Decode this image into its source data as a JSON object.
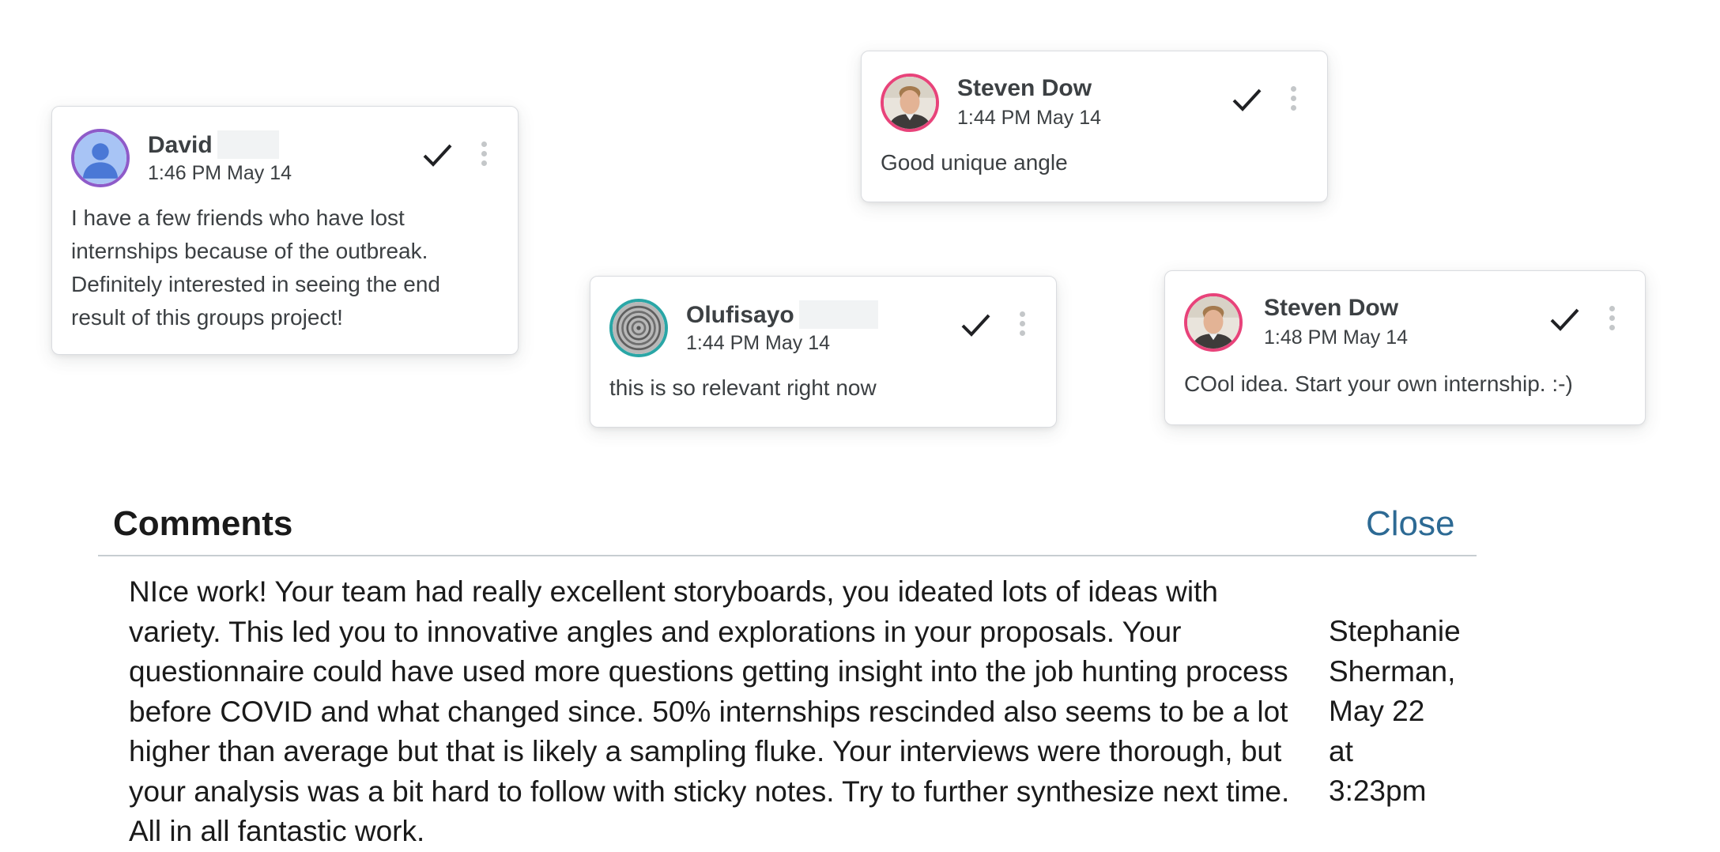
{
  "cards": [
    {
      "name": "David",
      "time": "1:46 PM May 14",
      "text": "I have a few friends who have lost internships because of the outbreak. Definitely interested in seeing the end result of this groups project!"
    },
    {
      "name": "Steven Dow",
      "time": "1:44 PM May 14",
      "text": "Good unique angle"
    },
    {
      "name": "Olufisayo",
      "time": "1:44 PM May 14",
      "text": "this is so relevant right now"
    },
    {
      "name": "Steven Dow",
      "time": "1:48 PM May 14",
      "text": "COol idea. Start your own internship. :-)"
    }
  ],
  "colors": {
    "avatar_ring_david": "#8e5bc9",
    "avatar_ring_steven": "#e8437a",
    "avatar_ring_olufisayo": "#2aa6a6",
    "link": "#2d6a94"
  },
  "icons": {
    "resolve": "checkmark-icon",
    "more": "more-vertical-icon",
    "default_avatar": "person-icon"
  },
  "comments_section": {
    "title": "Comments",
    "close_label": "Close",
    "comment": {
      "text": "NIce work!  Your team had really excellent storyboards, you ideated lots of ideas with variety. This led you to innovative angles and explorations in your proposals. Your questionnaire could have used more questions getting insight into the job hunting process before COVID and what changed since. 50% internships rescinded also seems to be a lot higher than average but that is likely a sampling fluke. Your interviews were thorough, but your analysis was a bit hard to follow with sticky notes. Try to further synthesize next time. All in all fantastic work.",
      "author": "Stephanie Sherman,",
      "date": "May 22",
      "at": "at",
      "time": "3:23pm"
    }
  }
}
